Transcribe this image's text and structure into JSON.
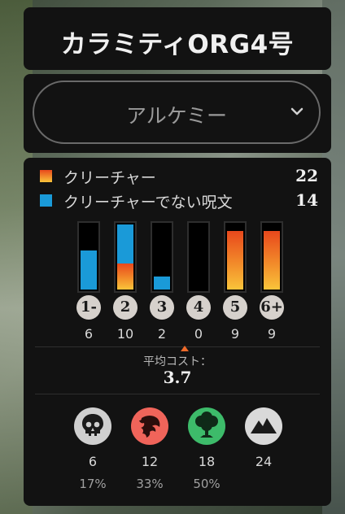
{
  "deck": {
    "title": "カラミティORG4号",
    "format": "アルケミー"
  },
  "legend": [
    {
      "label": "クリーチャー",
      "count": "22",
      "color": "#f08a2a",
      "icon": "creature-swatch"
    },
    {
      "label": "クリーチャーでない呪文",
      "count": "14",
      "color": "#1a9ad8",
      "icon": "spell-swatch"
    }
  ],
  "curve": [
    {
      "cost": "1-",
      "count": "6",
      "creatures": 0,
      "spells": 6
    },
    {
      "cost": "2",
      "count": "10",
      "creatures": 4,
      "spells": 6
    },
    {
      "cost": "3",
      "count": "2",
      "creatures": 0,
      "spells": 2
    },
    {
      "cost": "4",
      "count": "0",
      "creatures": 0,
      "spells": 0
    },
    {
      "cost": "5",
      "count": "9",
      "creatures": 9,
      "spells": 0
    },
    {
      "cost": "6+",
      "count": "9",
      "creatures": 9,
      "spells": 0
    }
  ],
  "curve_max": 10,
  "average": {
    "label": "平均コスト：",
    "value": "3.7"
  },
  "colors": [
    {
      "icon": "black-mana-skull-icon",
      "count": "6",
      "percent": "17%",
      "color": "#cfcfcf"
    },
    {
      "icon": "red-mana-dragon-icon",
      "count": "12",
      "percent": "33%",
      "color": "#f0645a"
    },
    {
      "icon": "green-mana-tree-icon",
      "count": "18",
      "percent": "50%",
      "color": "#3dbb6a"
    },
    {
      "icon": "colorless-mountain-icon",
      "count": "24",
      "percent": "",
      "color": "#d9d9d9"
    }
  ]
}
